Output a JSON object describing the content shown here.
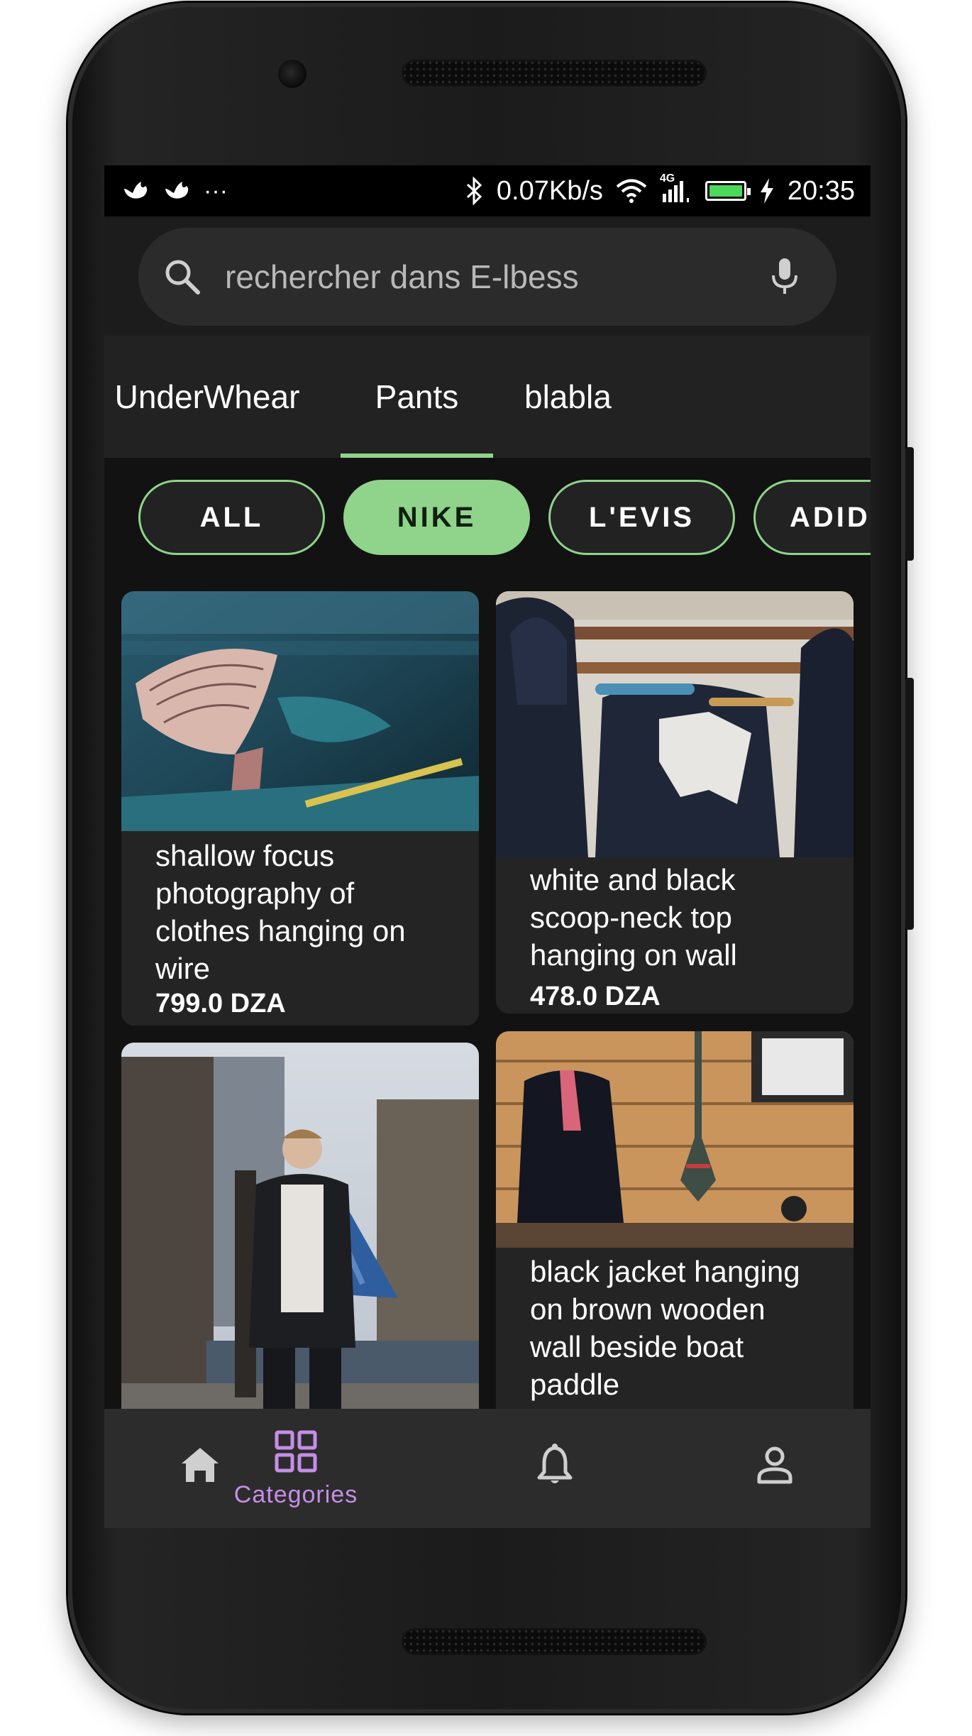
{
  "status_bar": {
    "network_speed": "0.07Kb/s",
    "network_type": "4G",
    "time": "20:35",
    "battery_level": 1.0,
    "left_icons": [
      "notification-bird-icon",
      "notification-bird-icon",
      "more-dots-icon"
    ],
    "right_icons": [
      "bluetooth-icon",
      "wifi-icon",
      "signal-icon",
      "battery-icon",
      "charging-icon"
    ]
  },
  "search": {
    "placeholder": "rechercher dans E-lbess",
    "icon": "search-icon",
    "voice_icon": "mic-icon"
  },
  "tabs": [
    {
      "label": "UnderWhear",
      "selected": false
    },
    {
      "label": "Pants",
      "selected": true
    },
    {
      "label": "blabla",
      "selected": false
    }
  ],
  "brand_filters": [
    {
      "label": "ALL",
      "selected": false
    },
    {
      "label": "NIKE",
      "selected": true
    },
    {
      "label": "L'EVIS",
      "selected": false
    },
    {
      "label": "ADIDA",
      "selected": false
    }
  ],
  "products": [
    {
      "title": "shallow focus\nphotography of\nclothes hanging on\nwire",
      "price": "799.0 DZA"
    },
    {
      "title": "white and black\nscoop-neck top\nhanging on wall",
      "price": "478.0 DZA"
    },
    {
      "title": "",
      "price": ""
    },
    {
      "title": "black jacket hanging\non brown wooden\nwall beside boat\npaddle",
      "price": ""
    }
  ],
  "bottom_nav": [
    {
      "label": "",
      "icon": "home-icon",
      "active": false
    },
    {
      "label": "Categories",
      "icon": "categories-icon",
      "active": true
    },
    {
      "label": "",
      "icon": "bell-icon",
      "active": false
    },
    {
      "label": "",
      "icon": "profile-icon",
      "active": false
    }
  ],
  "colors": {
    "accent_green": "#8fd48a",
    "active_nav_purple": "#c58ee6",
    "background": "#121212",
    "surface": "#242424",
    "battery_green": "#4cd95a"
  }
}
